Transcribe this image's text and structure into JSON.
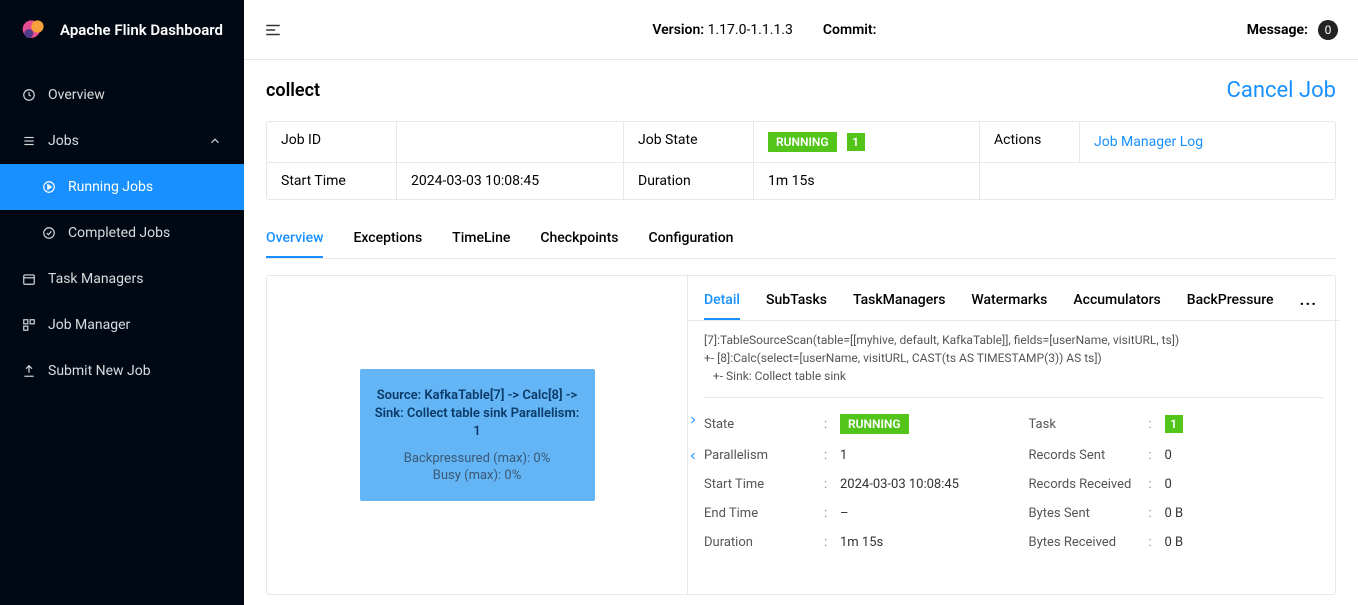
{
  "brand": {
    "title": "Apache Flink Dashboard"
  },
  "sidebar": {
    "overview": "Overview",
    "jobs": "Jobs",
    "running_jobs": "Running Jobs",
    "completed_jobs": "Completed Jobs",
    "task_managers": "Task Managers",
    "job_manager": "Job Manager",
    "submit_new_job": "Submit New Job"
  },
  "topbar": {
    "version_label": "Version:",
    "version_value": "1.17.0-1.1.1.3",
    "commit_label": "Commit:",
    "commit_value": "",
    "message_label": "Message:",
    "message_count": "0"
  },
  "page": {
    "title": "collect",
    "cancel": "Cancel Job"
  },
  "info": {
    "job_id_label": "Job ID",
    "job_id_value": "",
    "job_state_label": "Job State",
    "job_state_value": "RUNNING",
    "job_state_count": "1",
    "actions_label": "Actions",
    "actions_link": "Job Manager Log",
    "start_time_label": "Start Time",
    "start_time_value": "2024-03-03 10:08:45",
    "duration_label": "Duration",
    "duration_value": "1m 15s"
  },
  "tabs": {
    "overview": "Overview",
    "exceptions": "Exceptions",
    "timeline": "TimeLine",
    "checkpoints": "Checkpoints",
    "configuration": "Configuration"
  },
  "graph": {
    "node_title": "Source: KafkaTable[7] -> Calc[8] -> Sink: Collect table sink Parallelism: 1",
    "backpressure": "Backpressured (max): 0%",
    "busy": "Busy (max): 0%"
  },
  "detail_tabs": {
    "detail": "Detail",
    "subtasks": "SubTasks",
    "taskmanagers": "TaskManagers",
    "watermarks": "Watermarks",
    "accumulators": "Accumulators",
    "backpressure": "BackPressure",
    "more": "···"
  },
  "detail_code": "[7]:TableSourceScan(table=[[myhive, default, KafkaTable]], fields=[userName, visitURL, ts])\n+- [8]:Calc(select=[userName, visitURL, CAST(ts AS TIMESTAMP(3)) AS ts])\n   +- Sink: Collect table sink",
  "kv": {
    "state_label": "State",
    "state_value": "RUNNING",
    "task_label": "Task",
    "task_value": "1",
    "parallelism_label": "Parallelism",
    "parallelism_value": "1",
    "records_sent_label": "Records Sent",
    "records_sent_value": "0",
    "start_time_label": "Start Time",
    "start_time_value": "2024-03-03 10:08:45",
    "records_received_label": "Records Received",
    "records_received_value": "0",
    "end_time_label": "End Time",
    "end_time_value": "–",
    "bytes_sent_label": "Bytes Sent",
    "bytes_sent_value": "0 B",
    "duration_label": "Duration",
    "duration_value": "1m 15s",
    "bytes_received_label": "Bytes Received",
    "bytes_received_value": "0 B"
  }
}
